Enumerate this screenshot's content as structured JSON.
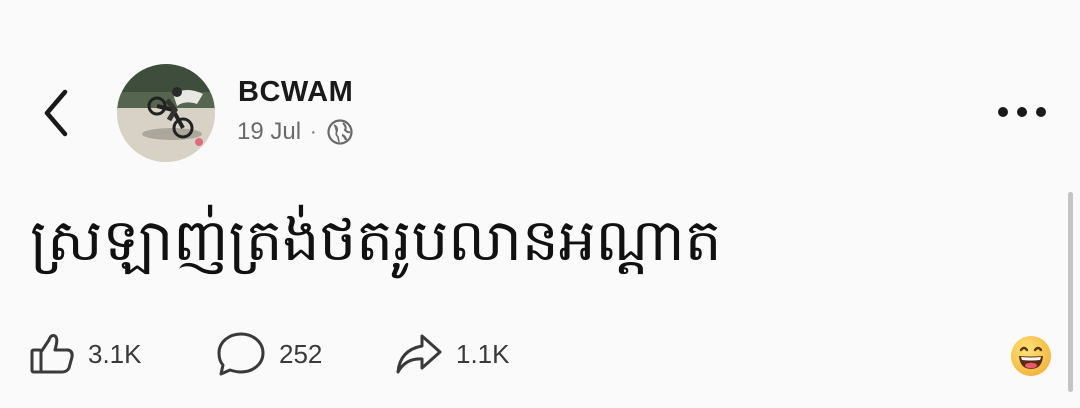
{
  "post": {
    "author": "BCWAM",
    "date": "19 Jul",
    "separator": "·",
    "visibility_icon": "globe-icon",
    "text": "ស្រឡាញ់ត្រង់ថតរូបលានអណ្ដាត"
  },
  "actions": {
    "likes": "3.1K",
    "comments": "252",
    "shares": "1.1K"
  },
  "icons": {
    "back": "chevron-left-icon",
    "more": "more-horizontal-icon",
    "like": "thumbs-up-icon",
    "comment": "comment-bubble-icon",
    "share": "share-arrow-icon",
    "reaction": "laughing-emoji-icon"
  },
  "colors": {
    "background": "#fafafa",
    "text": "#1c1c1c",
    "muted": "#6a6a6a",
    "emoji": "#f7c64a"
  }
}
